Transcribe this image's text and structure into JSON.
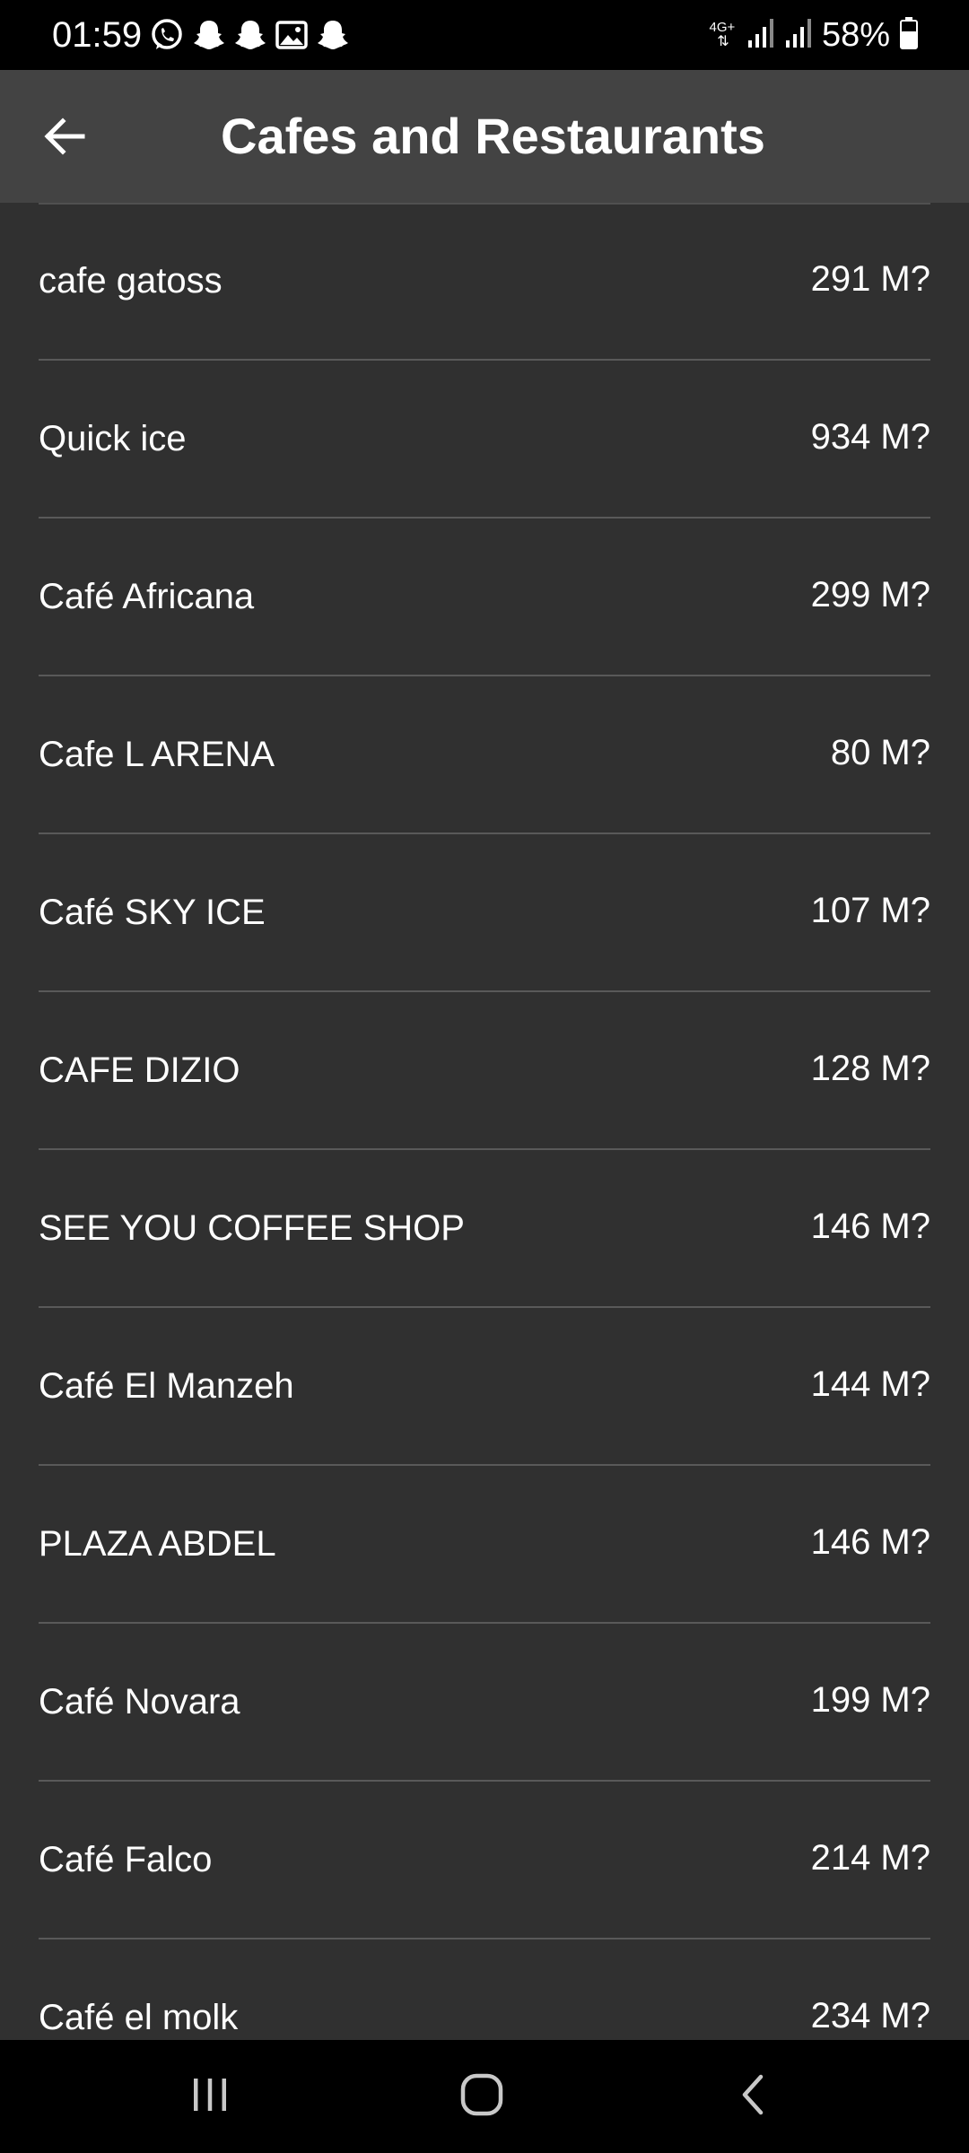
{
  "status_bar": {
    "time": "01:59",
    "network_label": "4G+",
    "battery_percent": "58%",
    "icons_left": [
      "whatsapp-icon",
      "snapchat-icon",
      "snapchat-icon",
      "gallery-icon",
      "snapchat-icon"
    ],
    "icons_right": [
      "signal-icon",
      "signal-icon",
      "battery-icon"
    ]
  },
  "app_bar": {
    "title": "Cafes and Restaurants",
    "back_icon": "arrow-left-icon"
  },
  "list": {
    "items": [
      {
        "name": "cafe gatoss",
        "distance": "291 M?"
      },
      {
        "name": "Quick ice",
        "distance": "934 M?"
      },
      {
        "name": "Café Africana",
        "distance": "299 M?"
      },
      {
        "name": "Cafe L ARENA",
        "distance": "80 M?"
      },
      {
        "name": "Café SKY ICE",
        "distance": "107 M?"
      },
      {
        "name": "CAFE DIZIO",
        "distance": "128 M?"
      },
      {
        "name": "SEE YOU COFFEE SHOP",
        "distance": "146 M?"
      },
      {
        "name": "Café El Manzeh",
        "distance": "144 M?"
      },
      {
        "name": "PLAZA ABDEL",
        "distance": "146 M?"
      },
      {
        "name": "Café Novara",
        "distance": "199 M?"
      },
      {
        "name": "Café Falco",
        "distance": "214 M?"
      },
      {
        "name": "Café el molk",
        "distance": "234 M?"
      }
    ]
  },
  "nav_bar": {
    "icons": [
      "recent-apps-icon",
      "home-icon",
      "back-icon"
    ]
  },
  "colors": {
    "status_bar_bg": "#000000",
    "app_bar_bg": "#434343",
    "list_bg": "#303030",
    "divider": "#595959",
    "text": "#ffffff"
  }
}
